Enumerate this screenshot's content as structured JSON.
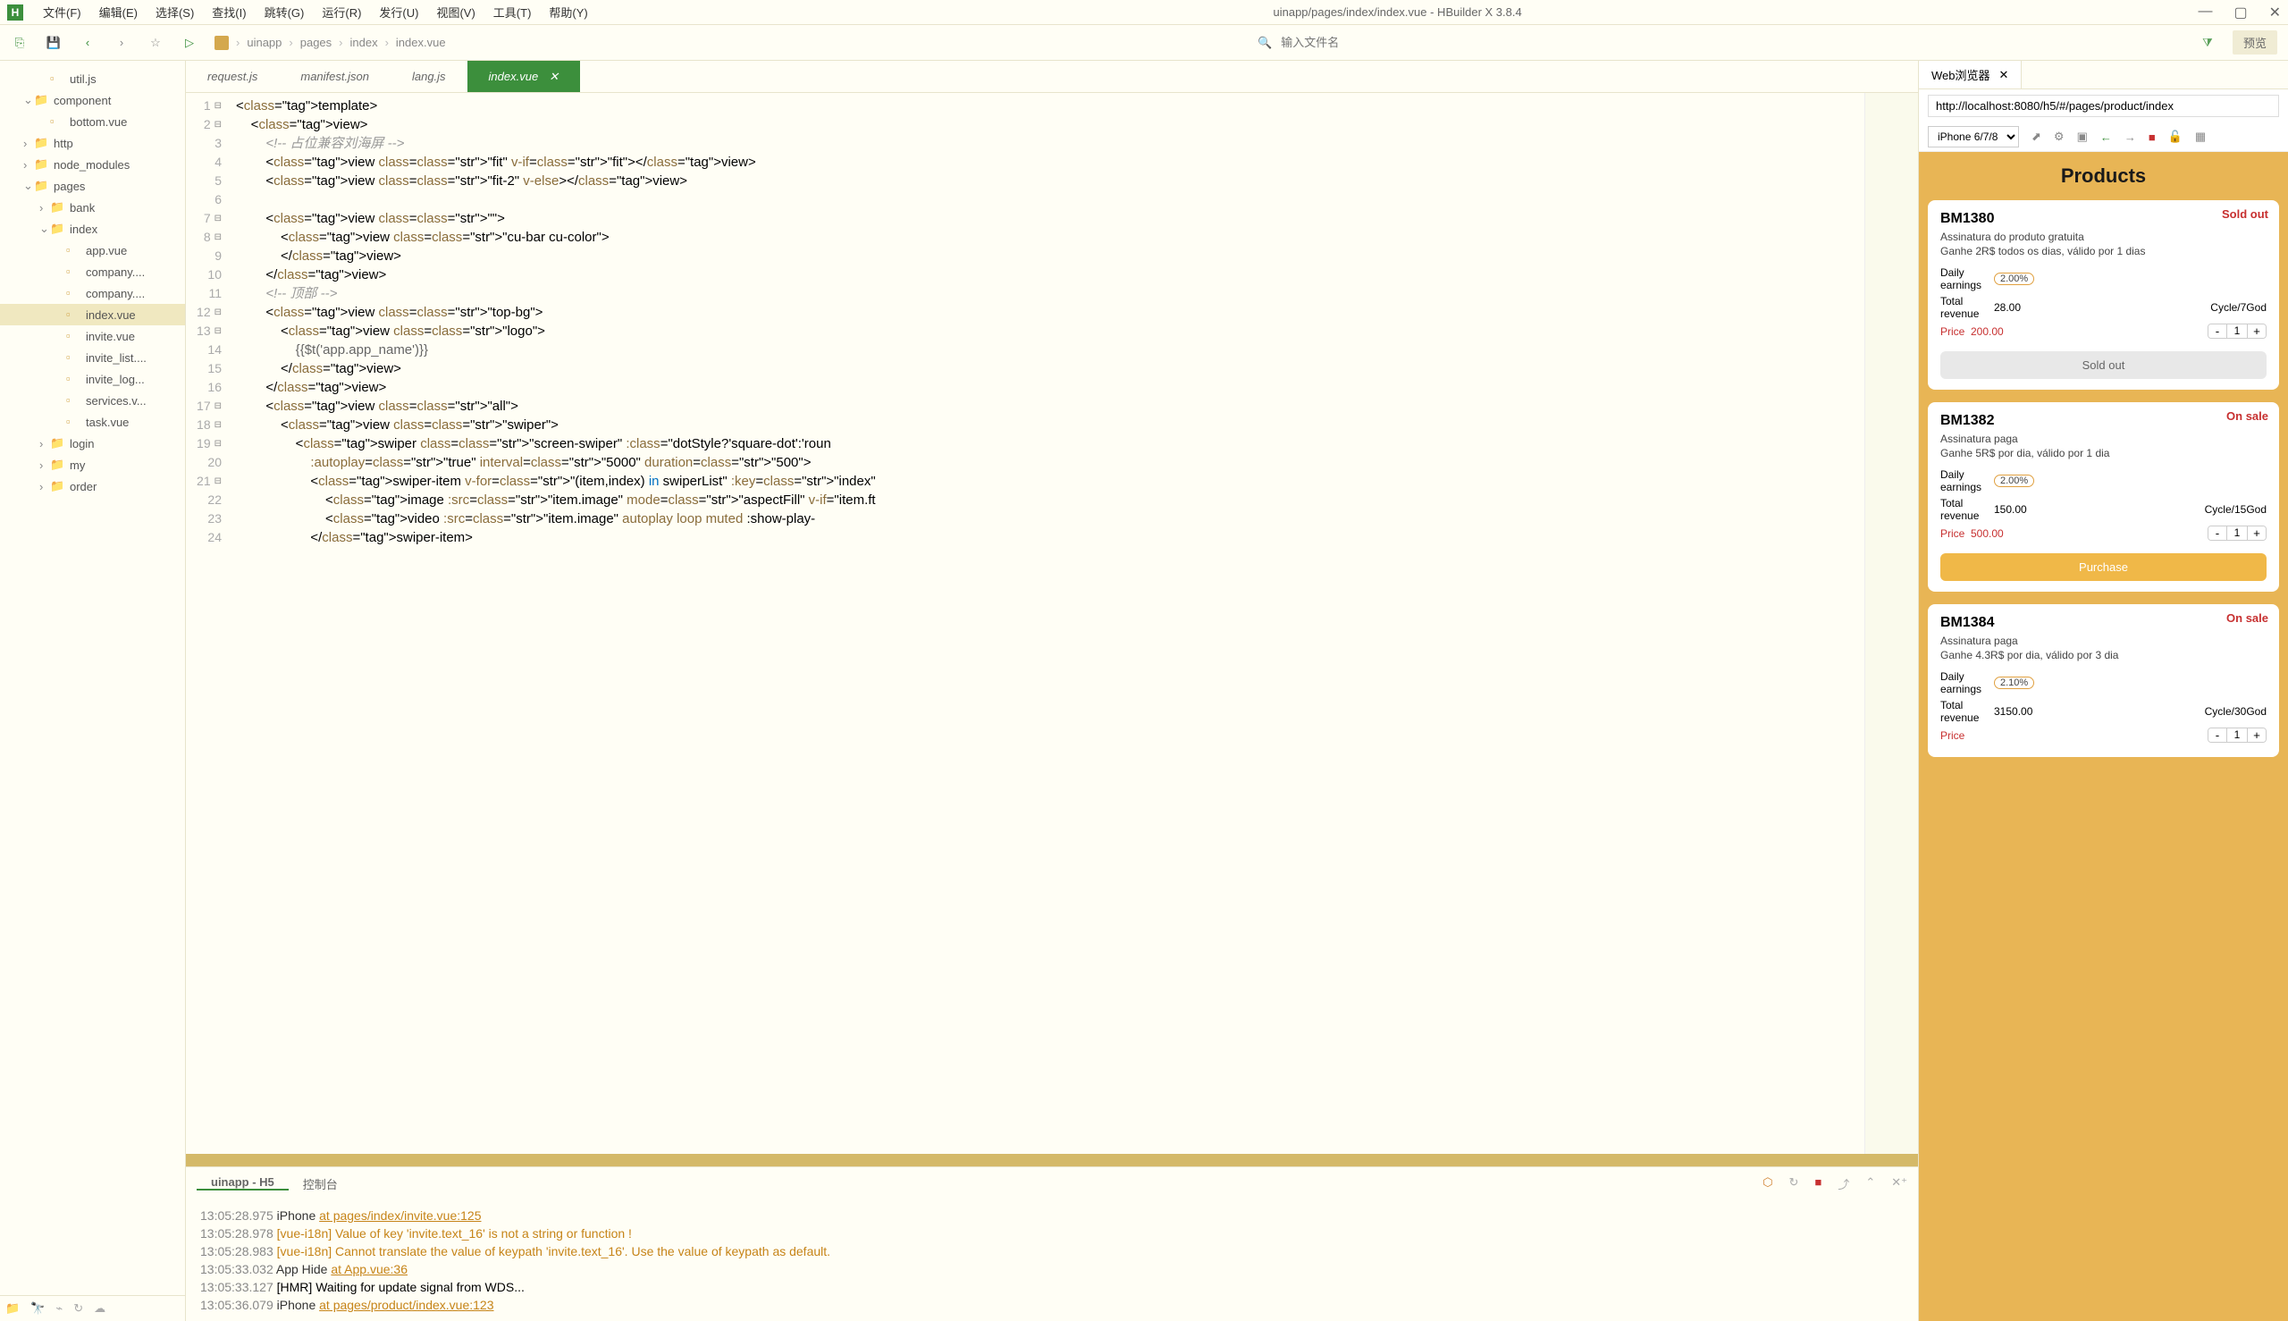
{
  "menubar": {
    "logo": "H",
    "items": [
      "文件(F)",
      "编辑(E)",
      "选择(S)",
      "查找(I)",
      "跳转(G)",
      "运行(R)",
      "发行(U)",
      "视图(V)",
      "工具(T)",
      "帮助(Y)"
    ],
    "title": "uinapp/pages/index/index.vue - HBuilder X 3.8.4"
  },
  "toolbar": {
    "breadcrumb": [
      "uinapp",
      "pages",
      "index",
      "index.vue"
    ],
    "search_placeholder": "输入文件名",
    "preview_label": "预览"
  },
  "sidebar": {
    "items": [
      {
        "depth": 2,
        "type": "file",
        "icon": "js",
        "label": "util.js"
      },
      {
        "depth": 1,
        "type": "folder",
        "expanded": true,
        "label": "component"
      },
      {
        "depth": 2,
        "type": "file",
        "icon": "vue",
        "label": "bottom.vue"
      },
      {
        "depth": 1,
        "type": "folder",
        "expanded": false,
        "label": "http"
      },
      {
        "depth": 1,
        "type": "folder",
        "expanded": false,
        "label": "node_modules"
      },
      {
        "depth": 1,
        "type": "folder",
        "expanded": true,
        "label": "pages"
      },
      {
        "depth": 2,
        "type": "folder",
        "expanded": false,
        "label": "bank"
      },
      {
        "depth": 2,
        "type": "folder",
        "expanded": true,
        "label": "index"
      },
      {
        "depth": 3,
        "type": "file",
        "icon": "vue",
        "label": "app.vue"
      },
      {
        "depth": 3,
        "type": "file",
        "icon": "vue",
        "label": "company...."
      },
      {
        "depth": 3,
        "type": "file",
        "icon": "vue",
        "label": "company...."
      },
      {
        "depth": 3,
        "type": "file",
        "icon": "vue",
        "label": "index.vue",
        "selected": true
      },
      {
        "depth": 3,
        "type": "file",
        "icon": "vue",
        "label": "invite.vue"
      },
      {
        "depth": 3,
        "type": "file",
        "icon": "vue",
        "label": "invite_list...."
      },
      {
        "depth": 3,
        "type": "file",
        "icon": "vue",
        "label": "invite_log..."
      },
      {
        "depth": 3,
        "type": "file",
        "icon": "vue",
        "label": "services.v..."
      },
      {
        "depth": 3,
        "type": "file",
        "icon": "vue",
        "label": "task.vue"
      },
      {
        "depth": 2,
        "type": "folder",
        "expanded": false,
        "label": "login"
      },
      {
        "depth": 2,
        "type": "folder",
        "expanded": false,
        "label": "my"
      },
      {
        "depth": 2,
        "type": "folder",
        "expanded": false,
        "label": "order"
      }
    ]
  },
  "tabs": [
    {
      "label": "request.js",
      "active": false
    },
    {
      "label": "manifest.json",
      "active": false
    },
    {
      "label": "lang.js",
      "active": false
    },
    {
      "label": "index.vue",
      "active": true
    }
  ],
  "code_lines": [
    "<template>",
    "    <view>",
    "        <!-- 占位兼容刘海屏 -->",
    "        <view class=\"fit\" v-if=\"fit\"></view>",
    "        <view class=\"fit-2\" v-else></view>",
    "",
    "        <view class=\"\">",
    "            <view class=\"cu-bar cu-color\">",
    "            </view>",
    "        </view>",
    "        <!-- 顶部 -->",
    "        <view class=\"top-bg\">",
    "            <view class=\"logo\">",
    "                {{$t('app.app_name')}}",
    "            </view>",
    "        </view>",
    "        <view class=\"all\">",
    "            <view class=\"swiper\">",
    "                <swiper class=\"screen-swiper\" :class=\"dotStyle?'square-dot':'roun",
    "                    :autoplay=\"true\" interval=\"5000\" duration=\"500\">",
    "                    <swiper-item v-for=\"(item,index) in swiperList\" :key=\"index\"",
    "                        <image :src=\"item.image\" mode=\"aspectFill\" v-if=\"item.ft",
    "                        <video :src=\"item.image\" autoplay loop muted :show-play-",
    "                    </swiper-item>"
  ],
  "console": {
    "tabs": [
      {
        "label": "uinapp - H5",
        "active": true
      },
      {
        "label": "控制台",
        "active": false
      }
    ],
    "lines": [
      {
        "ts": "13:05:28.975",
        "dev": "iPhone",
        "link": "at pages/index/invite.vue:125"
      },
      {
        "ts": "13:05:28.978",
        "warn": "[vue-i18n] Value of key 'invite.text_16' is not a string or function !"
      },
      {
        "ts": "13:05:28.983",
        "warn": "[vue-i18n] Cannot translate the value of keypath 'invite.text_16'. Use the value of keypath as default.",
        "wrap": true
      },
      {
        "ts": "13:05:33.032",
        "dev": "App Hide",
        "link": "at App.vue:36"
      },
      {
        "ts": "13:05:33.127",
        "text": "[HMR] Waiting for update signal from WDS..."
      },
      {
        "ts": "13:05:36.079",
        "dev": "iPhone",
        "link": "at pages/product/index.vue:123"
      }
    ]
  },
  "browser": {
    "tab_label": "Web浏览器",
    "url": "http://localhost:8080/h5/#/pages/product/index",
    "device": "iPhone 6/7/8",
    "header": "Products",
    "products": [
      {
        "badge": "Sold out",
        "badge_class": "sold",
        "name": "BM1380",
        "sub": "Assinatura do produto gratuita",
        "desc": "Ganhe 2R$ todos os dias, válido por 1 dias",
        "daily_label": "Daily earnings",
        "daily_pct": "2.00%",
        "total_label": "Total revenue",
        "total_val": "28.00",
        "cycle_label": "Cycle/7God",
        "price_label": "Price",
        "price_val": "200.00",
        "qty": "1",
        "btn": "Sold out",
        "btn_class": "sold"
      },
      {
        "badge": "On sale",
        "badge_class": "sale",
        "name": "BM1382",
        "sub": "Assinatura paga",
        "desc": "Ganhe 5R$ por dia, válido por 1 dia",
        "daily_label": "Daily earnings",
        "daily_pct": "2.00%",
        "total_label": "Total revenue",
        "total_val": "150.00",
        "cycle_label": "Cycle/15God",
        "price_label": "Price",
        "price_val": "500.00",
        "qty": "1",
        "btn": "Purchase",
        "btn_class": "active"
      },
      {
        "badge": "On sale",
        "badge_class": "sale",
        "name": "BM1384",
        "sub": "Assinatura paga",
        "desc": "Ganhe 4.3R$ por dia, válido por 3 dia",
        "daily_label": "Daily earnings",
        "daily_pct": "2.10%",
        "total_label": "Total revenue",
        "total_val": "3150.00",
        "cycle_label": "Cycle/30God",
        "price_label": "Price",
        "price_val": "",
        "qty": "1",
        "btn": "",
        "btn_class": ""
      }
    ]
  }
}
